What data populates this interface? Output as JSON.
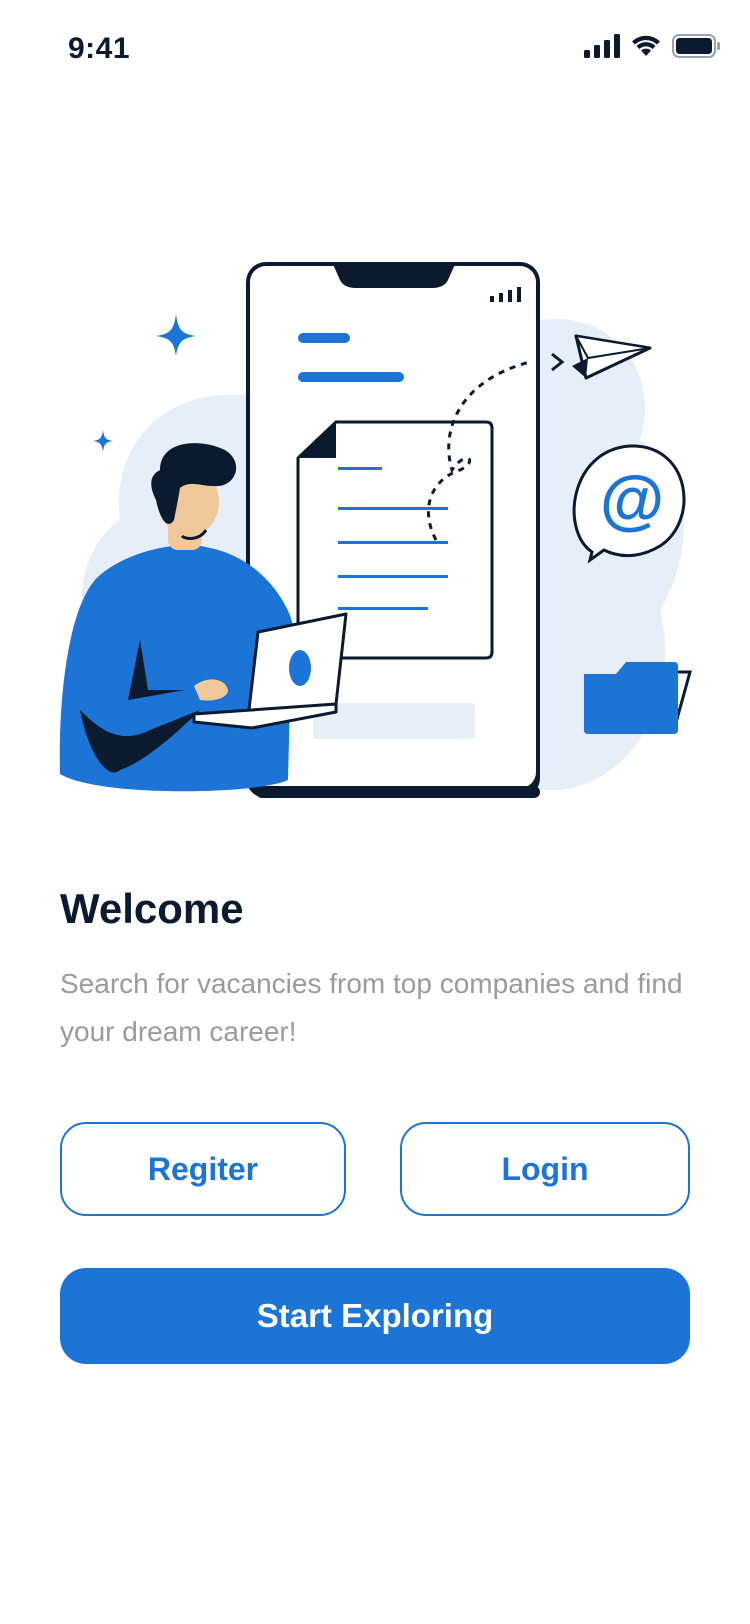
{
  "status_bar": {
    "time": "9:41",
    "icons": [
      "signal-icon",
      "wifi-icon",
      "battery-icon"
    ]
  },
  "illustration": {
    "icons": [
      "sparkle-icon",
      "paper-plane-icon",
      "at-sign-icon",
      "folder-icon",
      "document-icon",
      "laptop-icon",
      "person-icon",
      "phone-icon"
    ],
    "at_symbol": "@"
  },
  "welcome": {
    "title": "Welcome",
    "subtitle": "Search for vacancies from top companies and find your dream career!"
  },
  "buttons": {
    "register_label": "Regiter",
    "login_label": "Login",
    "start_label": "Start Exploring"
  },
  "colors": {
    "primary": "#1c75d6",
    "dark": "#0b1a2e",
    "muted_text": "#9b9b9b",
    "blob": "#e6eef8"
  }
}
